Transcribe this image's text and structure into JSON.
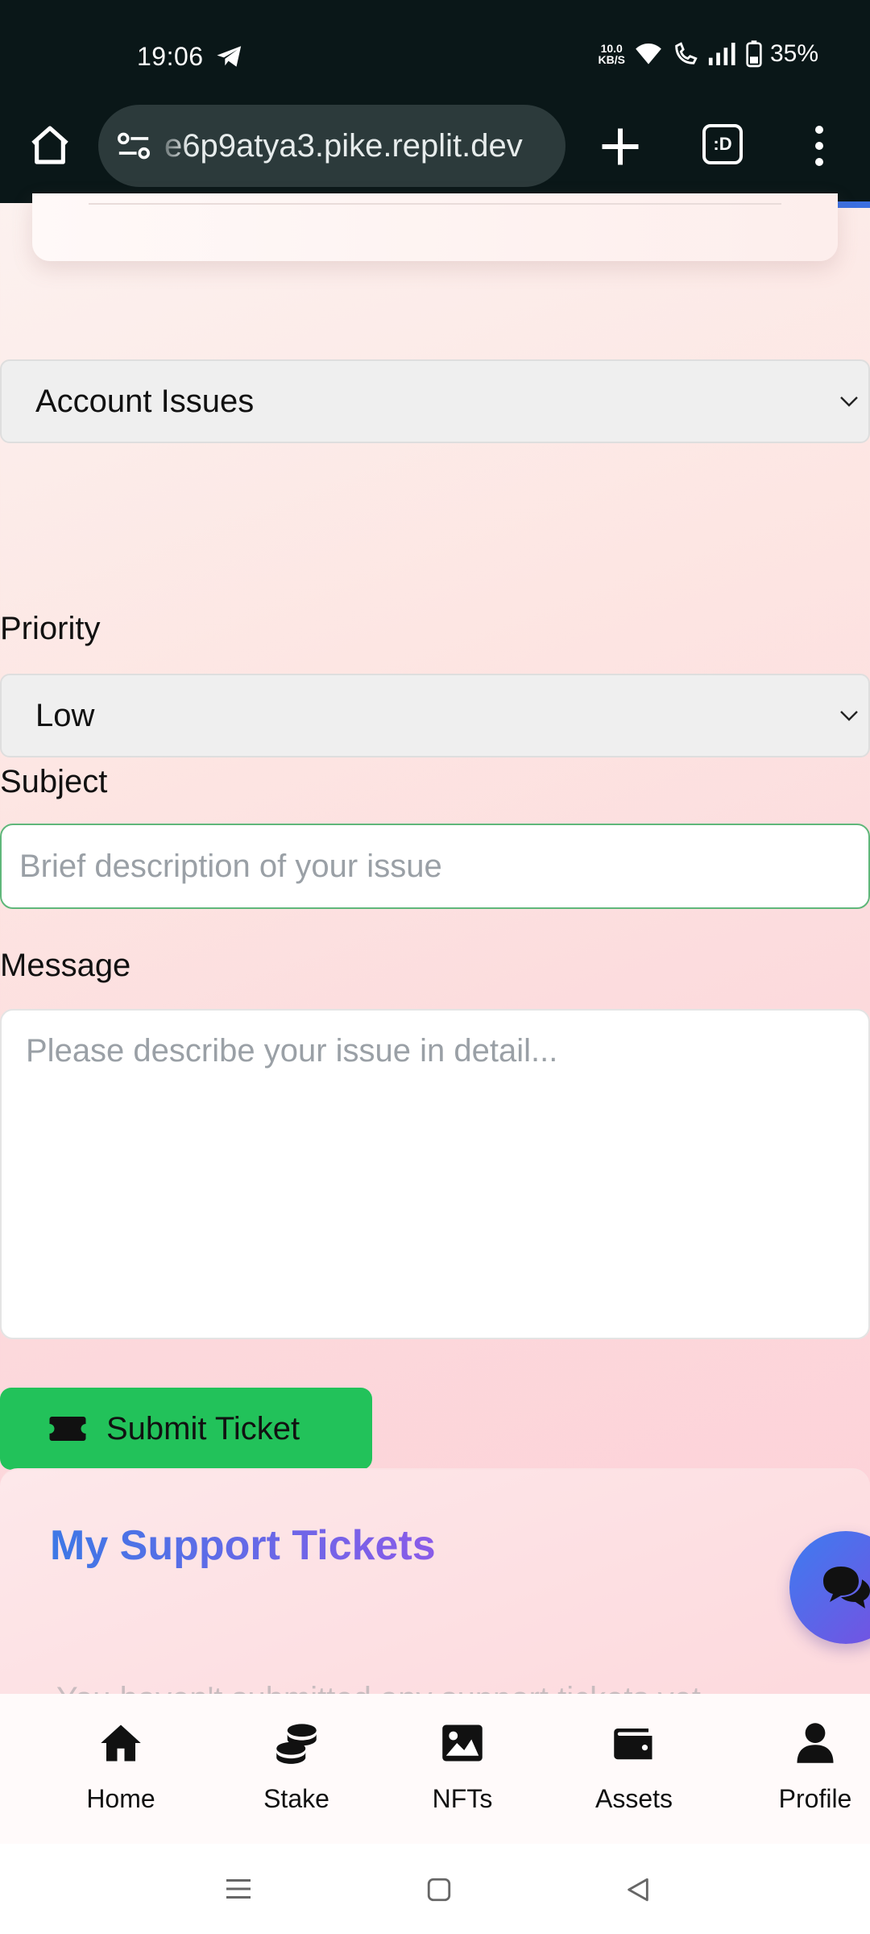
{
  "status_bar": {
    "time": "19:06",
    "net_speed_value": "10.0",
    "net_speed_unit": "KB/S",
    "battery": "35%"
  },
  "browser": {
    "url": "e6p9atya3.pike.replit.dev",
    "tabs_label": ":D"
  },
  "form": {
    "category_value": "Account Issues",
    "priority_label": "Priority",
    "priority_value": "Low",
    "subject_label": "Subject",
    "subject_placeholder": "Brief description of your issue",
    "message_label": "Message",
    "message_placeholder": "Please describe your issue in detail...",
    "submit_label": "Submit Ticket"
  },
  "tickets": {
    "title": "My Support Tickets",
    "empty_text": "You haven't submitted any support tickets yet."
  },
  "bottom_nav": {
    "items": [
      {
        "label": "Home",
        "icon": "home-icon"
      },
      {
        "label": "Stake",
        "icon": "coins-icon"
      },
      {
        "label": "NFTs",
        "icon": "image-icon"
      },
      {
        "label": "Assets",
        "icon": "wallet-icon"
      },
      {
        "label": "Profile",
        "icon": "user-icon"
      }
    ]
  },
  "colors": {
    "submit": "#22c25a",
    "accent_start": "#3d78e6",
    "accent_end": "#8a5be8",
    "status_bar": "#0a1718"
  }
}
